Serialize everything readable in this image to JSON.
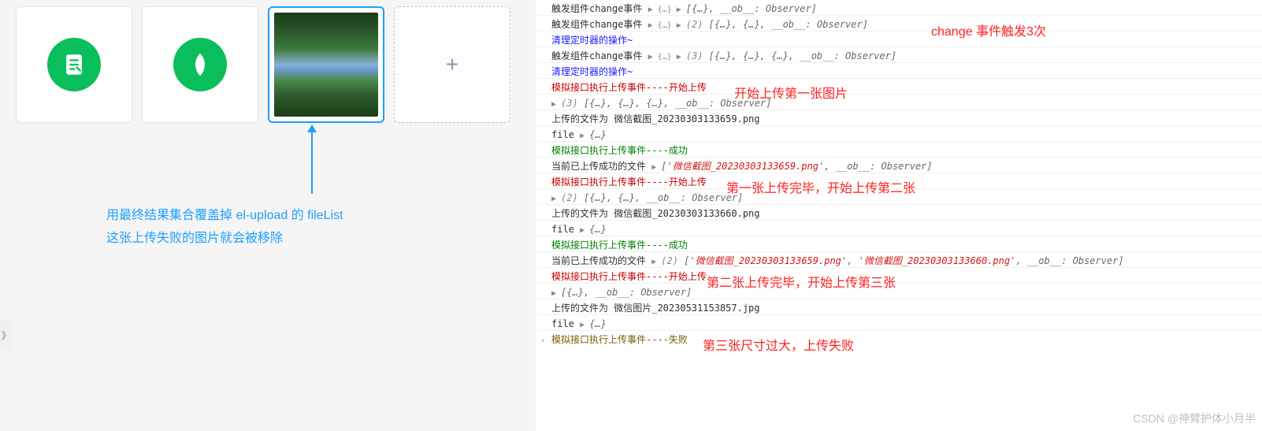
{
  "left": {
    "annotation_line1": "用最终结果集合覆盖掉 el-upload 的 fileList",
    "annotation_line2": "这张上传失败的图片就会被移除",
    "expand_glyph": "》",
    "plus": "+"
  },
  "notes": {
    "n0": "change 事件触发3次",
    "n1": "开始上传第一张图片",
    "n2": "第一张上传完毕，开始上传第二张",
    "n3": "第二张上传完毕，开始上传第三张",
    "n4": "第三张尺寸过大，上传失败"
  },
  "logs": [
    {
      "cls": "black",
      "pre": "触发组件change事件 ",
      "arr": "▶ {…} ▶ ",
      "tail": "[{…}, __ob__: Observer]",
      "tailCls": "purple"
    },
    {
      "cls": "black",
      "pre": "触发组件change事件 ",
      "arr": "▶ {…} ▶ ",
      "count": "(2) ",
      "tail": "[{…}, {…}, __ob__: Observer]",
      "tailCls": "purple"
    },
    {
      "cls": "blue",
      "pre": "清理定时器的操作~"
    },
    {
      "cls": "black",
      "pre": "触发组件change事件 ",
      "arr": "▶ {…} ▶ ",
      "count": "(3) ",
      "tail": "[{…}, {…}, {…}, __ob__: Observer]",
      "tailCls": "purple"
    },
    {
      "cls": "blue",
      "pre": "清理定时器的操作~"
    },
    {
      "cls": "red",
      "pre": "模拟接口执行上传事件----开始上传"
    },
    {
      "cls": "black",
      "arr": "▶ ",
      "count": "(3) ",
      "tail": "[{…}, {…}, {…}, __ob__: Observer]",
      "tailCls": "purple"
    },
    {
      "cls": "black",
      "pre": "上传的文件为 微信截图_20230303133659.png"
    },
    {
      "cls": "black",
      "pre": "file ",
      "arr": "▶ ",
      "tail": "{…}",
      "tailCls": "purple"
    },
    {
      "cls": "green",
      "pre": "模拟接口执行上传事件----成功"
    },
    {
      "cls": "black",
      "pre": "当前已上传成功的文件 ",
      "arr": "▶ ",
      "tail": "['",
      "r1": "微信截图_20230303133659.png",
      "post": "', __ob__: Observer]"
    },
    {
      "cls": "red",
      "pre": "模拟接口执行上传事件----开始上传"
    },
    {
      "cls": "black",
      "arr": "▶ ",
      "count": "(2) ",
      "tail": "[{…}, {…}, __ob__: Observer]",
      "tailCls": "purple"
    },
    {
      "cls": "black",
      "pre": "上传的文件为 微信截图_20230303133660.png"
    },
    {
      "cls": "black",
      "pre": "file ",
      "arr": "▶ ",
      "tail": "{…}",
      "tailCls": "purple"
    },
    {
      "cls": "green",
      "pre": "模拟接口执行上传事件----成功"
    },
    {
      "cls": "black",
      "pre": "当前已上传成功的文件 ",
      "arr": "▶ ",
      "count": "(2) ",
      "tail": "['",
      "r1": "微信截图_20230303133659.png",
      "mid": "', '",
      "r2": "微信截图_20230303133660.png",
      "post": "', __ob__: Observer]"
    },
    {
      "cls": "red",
      "pre": "模拟接口执行上传事件----开始上传"
    },
    {
      "cls": "black",
      "arr": "▶ ",
      "tail": "[{…}, __ob__: Observer]",
      "tailCls": "purple"
    },
    {
      "cls": "black",
      "pre": "上传的文件为 微信图片_20230531153857.jpg"
    },
    {
      "cls": "black",
      "pre": "file ",
      "arr": "▶ ",
      "tail": "{…}",
      "tailCls": "purple"
    },
    {
      "cls": "olive",
      "pre": "模拟接口执行上传事件----失败"
    }
  ],
  "watermark": "CSDN @神臂护体小月半"
}
